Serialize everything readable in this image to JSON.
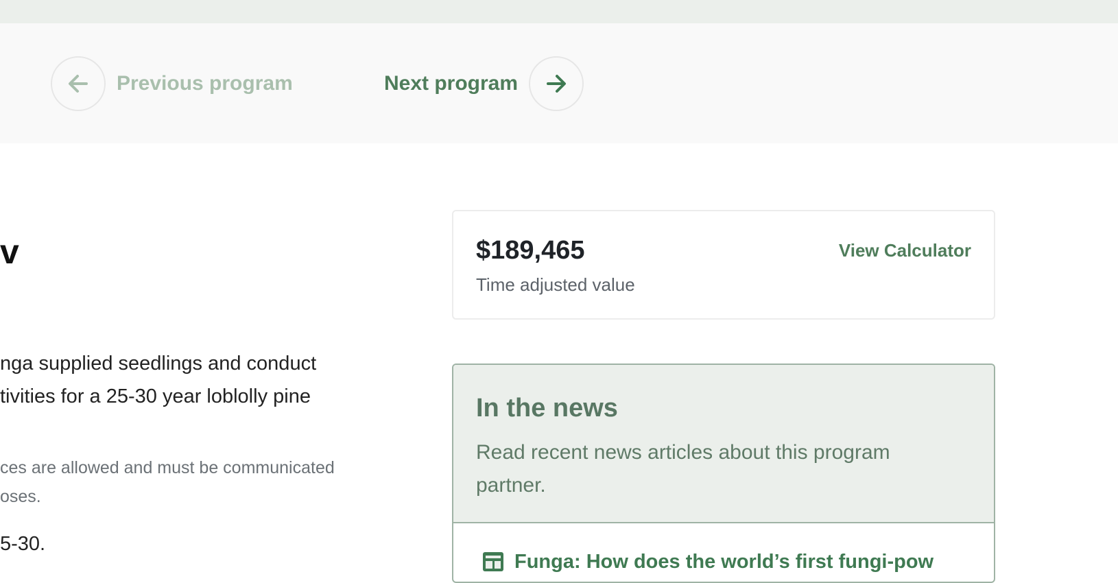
{
  "navigation": {
    "previous_label": "Previous program",
    "next_label": "Next program",
    "previous_icon": "arrow-left-icon",
    "next_icon": "arrow-right-icon"
  },
  "main": {
    "heading_fragment": "v",
    "paragraph_lines": [
      "nga supplied seedlings and conduct",
      "tivities for a 25-30 year loblolly pine"
    ],
    "note_lines": [
      "ces are allowed and must be communicated",
      "oses."
    ],
    "range_fragment": "5-30."
  },
  "value_card": {
    "amount": "$189,465",
    "caption": "Time adjusted value",
    "link_label": "View Calculator"
  },
  "news": {
    "title": "In the news",
    "description": "Read recent news articles about this program partner.",
    "items": [
      {
        "icon": "newspaper-icon",
        "title": "Funga: How does the world’s first fungi-pow"
      }
    ]
  },
  "colors": {
    "accent": "#4f7d5b",
    "accent_muted": "#a9bfad",
    "news_bg": "#ebefeb",
    "news_border": "#9fb3a5"
  }
}
